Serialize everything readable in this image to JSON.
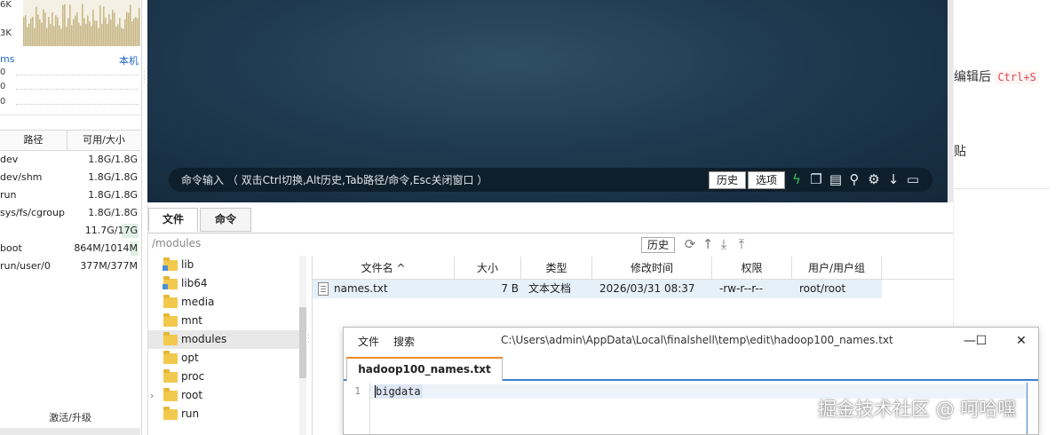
{
  "monitor": {
    "cpu_labels": [
      "6K",
      "3K"
    ],
    "net_ms": "ms",
    "net_host": "本机",
    "net_values": [
      "0",
      "0",
      "0"
    ],
    "disk_headers": {
      "path": "路径",
      "size": "可用/大小"
    },
    "disks": [
      {
        "path": "dev",
        "size": "1.8G/1.8G",
        "usage_pct": 0
      },
      {
        "path": "dev/shm",
        "size": "1.8G/1.8G",
        "usage_pct": 0
      },
      {
        "path": "run",
        "size": "1.8G/1.8G",
        "usage_pct": 0
      },
      {
        "path": "sys/fs/cgroup",
        "size": "1.8G/1.8G",
        "usage_pct": 0
      },
      {
        "path": "",
        "size": "11.7G/17G",
        "usage_pct": 30
      },
      {
        "path": "boot",
        "size": "864M/1014M",
        "usage_pct": 15
      },
      {
        "path": "run/user/0",
        "size": "377M/377M",
        "usage_pct": 0
      }
    ],
    "activate_label": "激活/升级"
  },
  "terminal": {
    "command_hint": "命令输入 （ 双击Ctrl切换,Alt历史,Tab路径/命令,Esc关闭窗口 ）",
    "history_button": "历史",
    "options_button": "选项",
    "icons": [
      "lightning-icon",
      "copy-icon",
      "paste-icon",
      "search-icon",
      "gear-icon",
      "arrow-down-icon",
      "window-icon"
    ],
    "colors": {
      "background": "#1f3a50",
      "bar": "#0f1e2b",
      "lightning": "#34c759"
    }
  },
  "file_panel": {
    "tabs": [
      "文件",
      "命令"
    ],
    "path": "/modules",
    "history_button": "历史",
    "path_icons": [
      "refresh-icon",
      "up-icon",
      "download-icon",
      "upload-icon"
    ],
    "tree": [
      {
        "label": "lib",
        "link": true,
        "selected": false,
        "expander": false
      },
      {
        "label": "lib64",
        "link": true,
        "selected": false,
        "expander": false
      },
      {
        "label": "media",
        "link": false,
        "selected": false,
        "expander": false
      },
      {
        "label": "mnt",
        "link": false,
        "selected": false,
        "expander": false
      },
      {
        "label": "modules",
        "link": false,
        "selected": true,
        "expander": false
      },
      {
        "label": "opt",
        "link": false,
        "selected": false,
        "expander": false
      },
      {
        "label": "proc",
        "link": false,
        "selected": false,
        "expander": false
      },
      {
        "label": "root",
        "link": false,
        "selected": false,
        "expander": true
      },
      {
        "label": "run",
        "link": false,
        "selected": false,
        "expander": false
      }
    ],
    "columns": [
      "文件名 ^",
      "大小",
      "类型",
      "修改时间",
      "权限",
      "用户/用户组"
    ],
    "files": [
      {
        "name": "names.txt",
        "size": "7 B",
        "type": "文本文档",
        "modified": "2026/03/31 08:37",
        "permissions": "-rw-r--r--",
        "owner": "root/root"
      }
    ]
  },
  "doc": {
    "edit_text": "编辑后",
    "edit_shortcut": "Ctrl+S",
    "paste_text": "贴"
  },
  "editor": {
    "menu": [
      "文件",
      "搜索"
    ],
    "path": "C:\\Users\\admin\\AppData\\Local\\finalshell\\temp\\edit\\hadoop100_names.txt",
    "controls": [
      "minimize-icon",
      "maximize-icon",
      "close-icon"
    ],
    "tab": "hadoop100_names.txt",
    "line_number": "1",
    "content": "bigdata"
  },
  "watermark": "掘金技术社区 @ 呵哈嘿"
}
